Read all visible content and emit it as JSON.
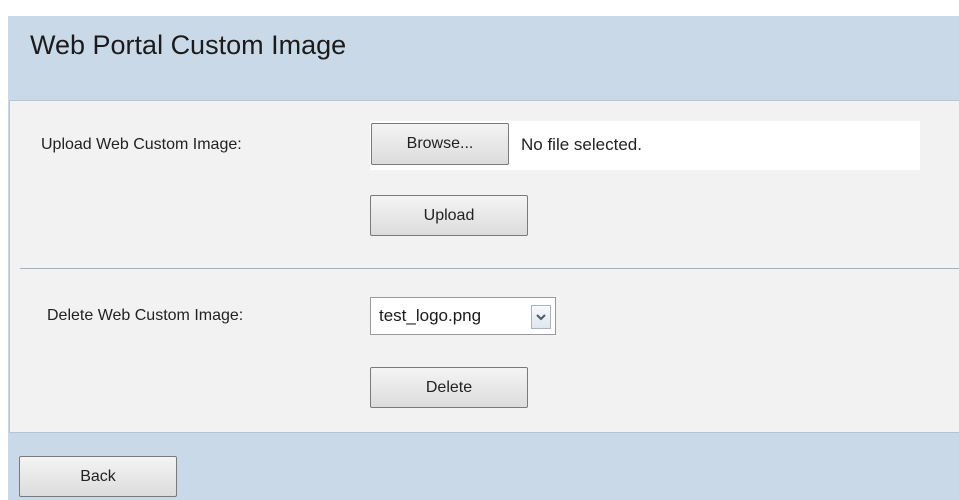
{
  "page": {
    "title": "Web Portal Custom Image"
  },
  "upload": {
    "label": "Upload Web Custom Image:",
    "browse_label": "Browse...",
    "file_status": "No file selected.",
    "upload_label": "Upload"
  },
  "delete": {
    "label": "Delete Web Custom Image:",
    "selected_image": "test_logo.png",
    "delete_label": "Delete"
  },
  "footer": {
    "back_label": "Back"
  },
  "icons": {
    "dropdown": "chevron-down-icon"
  },
  "colors": {
    "header_band": "#c9d9e8",
    "panel_bg": "#f2f2f2"
  }
}
